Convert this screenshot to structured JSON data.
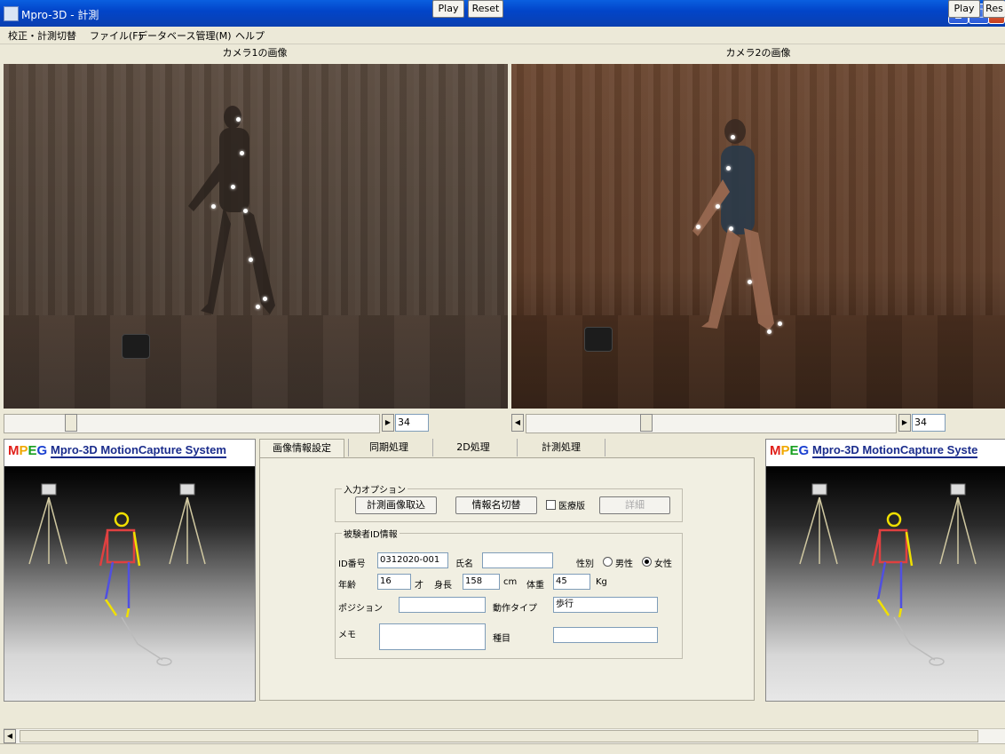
{
  "window": {
    "title": "Mpro-3D - 計測",
    "minimize": "_",
    "maximize": "□",
    "close": "X"
  },
  "menu": [
    "校正・計測切替",
    "ファイル(F)",
    "データベース管理(M)",
    "ヘルプ"
  ],
  "cameras": {
    "cam1_label": "カメラ1の画像",
    "cam2_label": "カメラ2の画像"
  },
  "playback": {
    "cam1": {
      "frame": "34",
      "play": "Play",
      "reset": "Reset",
      "position": 0.17
    },
    "cam2": {
      "frame": "34",
      "play": "Play",
      "reset": "Res",
      "position": 0.32
    }
  },
  "brand": {
    "logo": "MPEG",
    "title": "Mpro-3D MotionCapture System",
    "title_right": "Mpro-3D MotionCapture Syste"
  },
  "tabs": [
    "画像情報設定",
    "同期処理",
    "2D処理",
    "計測処理"
  ],
  "input_options": {
    "group_label": "入力オプション",
    "btn_load": "計測画像取込",
    "btn_switch": "情報名切替",
    "medical_label": "医療版",
    "btn_detail": "詳細"
  },
  "subject": {
    "group_label": "被験者ID情報",
    "id_label": "ID番号",
    "id_value": "0312020-001",
    "name_label": "氏名",
    "name_value": "",
    "sex_label": "性別",
    "male": "男性",
    "female": "女性",
    "age_label": "年齢",
    "age_value": "16",
    "age_unit": "才",
    "height_label": "身長",
    "height_value": "158",
    "height_unit": "cm",
    "weight_label": "体重",
    "weight_value": "45",
    "weight_unit": "Kg",
    "position_label": "ポジション",
    "position_value": "",
    "motion_label": "動作タイプ",
    "motion_value": "歩行",
    "memo_label": "メモ",
    "memo_value": "",
    "event_label": "種目",
    "event_value": ""
  }
}
